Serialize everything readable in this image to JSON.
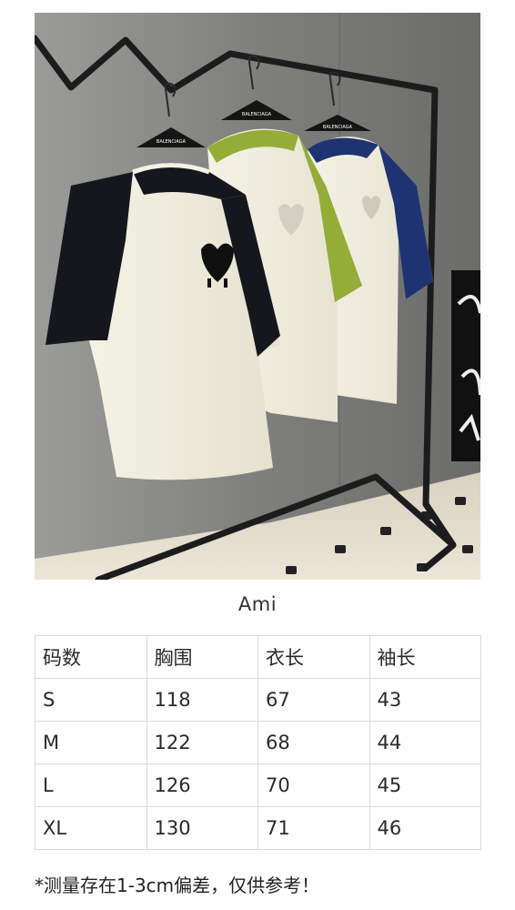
{
  "product_photo": {
    "description_icon": "tshirts-on-rack-photo",
    "hanger_brand_text": "BALENCIAGA",
    "colors": {
      "wall": "#8a8a88",
      "floor": "#e6dfd0",
      "body_cream": "#f1efe0",
      "sleeve_black": "#15171c",
      "sleeve_green": "#93ad38",
      "sleeve_navy": "#1e3372",
      "rack": "#1d1d1f"
    }
  },
  "brand": "Ami",
  "size_table": {
    "headers": [
      "码数",
      "胸围",
      "衣长",
      "袖长"
    ],
    "rows": [
      [
        "S",
        "118",
        "67",
        "43"
      ],
      [
        "M",
        "122",
        "68",
        "44"
      ],
      [
        "L",
        "126",
        "70",
        "45"
      ],
      [
        "XL",
        "130",
        "71",
        "46"
      ]
    ]
  },
  "note": "*测量存在1-3cm偏差，仅供参考！"
}
